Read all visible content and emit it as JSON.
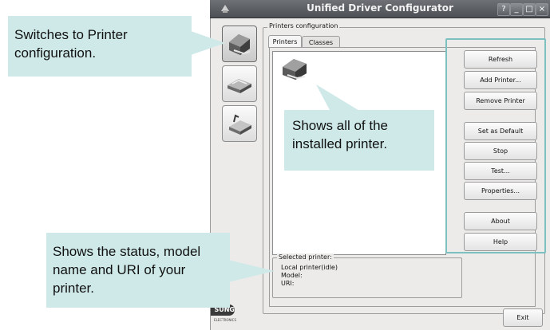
{
  "window": {
    "title": "Unified Driver Configurator",
    "controls": {
      "help": "?",
      "minimize": "_",
      "maximize": "□",
      "close": "×"
    }
  },
  "sidebar": {
    "items": [
      {
        "name": "printer-configuration",
        "icon": "printer-icon",
        "active": true
      },
      {
        "name": "scanner-configuration",
        "icon": "scanner-icon",
        "active": false
      },
      {
        "name": "ports-configuration",
        "icon": "port-icon",
        "active": false
      }
    ]
  },
  "printers_group": {
    "label": "Printers configuration"
  },
  "tabs": [
    {
      "label": "Printers",
      "active": true
    },
    {
      "label": "Classes",
      "active": false
    }
  ],
  "buttons": {
    "refresh": "Refresh",
    "add_printer": "Add Printer...",
    "remove_printer": "Remove Printer",
    "set_default": "Set as Default",
    "stop": "Stop",
    "test": "Test...",
    "properties": "Properties...",
    "about": "About",
    "help": "Help",
    "exit": "Exit"
  },
  "selected_printer": {
    "label": "Selected printer:",
    "status": "Local printer(idle)",
    "model": "Model:",
    "uri": "URI:"
  },
  "brand": {
    "line1": "SUNG",
    "line2": "ELECTRONICS"
  },
  "callouts": {
    "printer_config": "Switches to Printer configuration.",
    "installed": "Shows all of the installed printer.",
    "status": "Shows the status, model name and URI of your printer."
  },
  "colors": {
    "callout": "#cfe9e9",
    "highlight": "#7cc0c0",
    "titlebar": "#5a5d62"
  }
}
